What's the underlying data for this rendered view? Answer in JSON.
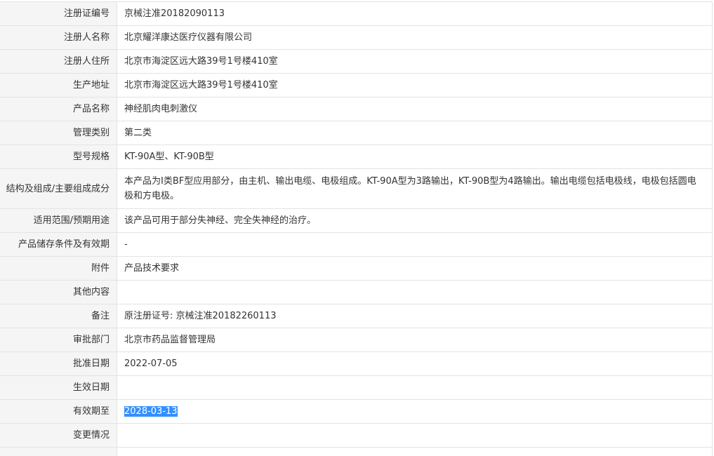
{
  "rows": [
    {
      "label": "注册证编号",
      "value": "京械注准20182090113"
    },
    {
      "label": "注册人名称",
      "value": "北京耀洋康达医疗仪器有限公司"
    },
    {
      "label": "注册人住所",
      "value": "北京市海淀区远大路39号1号楼410室"
    },
    {
      "label": "生产地址",
      "value": "北京市海淀区远大路39号1号楼410室"
    },
    {
      "label": "产品名称",
      "value": "神经肌肉电刺激仪"
    },
    {
      "label": "管理类别",
      "value": "第二类"
    },
    {
      "label": "型号规格",
      "value": "KT-90A型、KT-90B型"
    },
    {
      "label": "结构及组成/主要组成成分",
      "value": "本产品为Ⅰ类BF型应用部分，由主机、输出电缆、电极组成。KT-90A型为3路输出，KT-90B型为4路输出。输出电缆包括电极线，电极包括圆电极和方电极。"
    },
    {
      "label": "适用范围/预期用途",
      "value": "该产品可用于部分失神经、完全失神经的治疗。"
    },
    {
      "label": "产品储存条件及有效期",
      "value": "-"
    },
    {
      "label": "附件",
      "value": "产品技术要求"
    },
    {
      "label": "其他内容",
      "value": ""
    },
    {
      "label": "备注",
      "value": "原注册证号: 京械注准20182260113"
    },
    {
      "label": "审批部门",
      "value": "北京市药品监督管理局"
    },
    {
      "label": "批准日期",
      "value": "2022-07-05"
    },
    {
      "label": "生效日期",
      "value": ""
    },
    {
      "label": "有效期至",
      "value": "2028-03-13"
    },
    {
      "label": "变更情况",
      "value": ""
    }
  ],
  "selection_color": "#3390ff"
}
